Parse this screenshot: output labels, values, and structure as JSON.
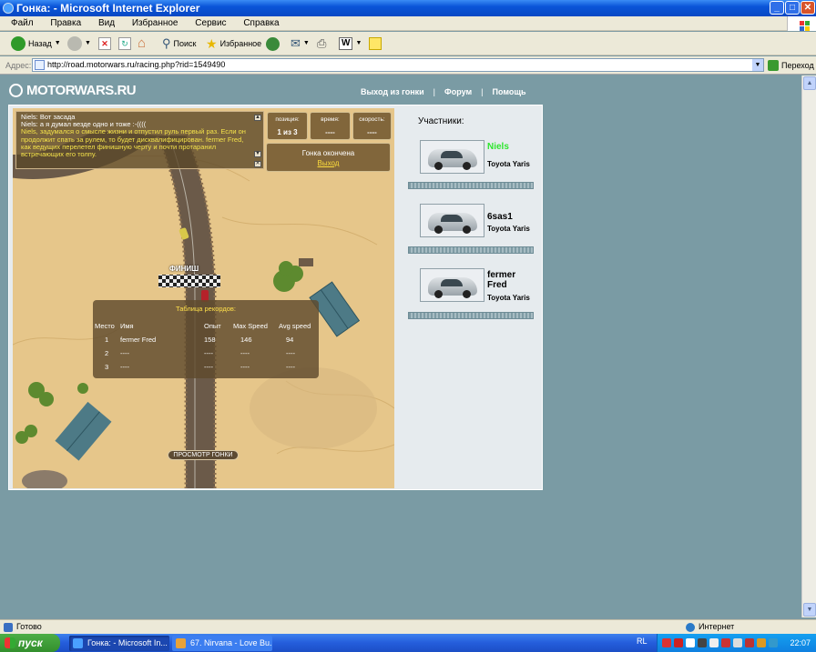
{
  "window": {
    "title": "Гонка: - Microsoft Internet Explorer"
  },
  "menu": [
    "Файл",
    "Правка",
    "Вид",
    "Избранное",
    "Сервис",
    "Справка"
  ],
  "toolbar": {
    "back": "Назад",
    "search": "Поиск",
    "favorites": "Избранное"
  },
  "address": {
    "label": "Адрес:",
    "url": "http://road.motorwars.ru/racing.php?rid=1549490",
    "go": "Переход"
  },
  "site": {
    "logo": "MOTORWARS.RU",
    "nav": [
      "Выход из гонки",
      "Форум",
      "Помощь"
    ]
  },
  "chat": [
    {
      "name": "Niels:",
      "text": "Вот засада"
    },
    {
      "name": "Niels:",
      "text": "а я думал везде одно и тоже :-(((("
    }
  ],
  "chat_system": "Niels, задумался о смысле жизни и отпустил руль первый раз. Если он продолжит спать за рулем, то будет дисквалифицирован. fermer Fred, как ведущих перелетел финишную черту и почти протаранил встречающих его толпу.",
  "stats": {
    "position_label": "позиция:",
    "position": "1 из 3",
    "time_label": "время:",
    "time": "----",
    "speed_label": "скорость:",
    "speed": "----"
  },
  "status": {
    "text": "Гонка окончена",
    "link": "Выход"
  },
  "finish_label": "ФИНИШ",
  "records": {
    "title": "Таблица рекордов:",
    "headers": [
      "Место",
      "Имя",
      "Опыт",
      "Max Speed",
      "Avg speed"
    ],
    "rows": [
      [
        "1",
        "fermer Fred",
        "158",
        "146",
        "94"
      ],
      [
        "2",
        "----",
        "----",
        "----",
        "----"
      ],
      [
        "3",
        "----",
        "----",
        "----",
        "----"
      ]
    ]
  },
  "replay": "ПРОСМОТР ГОНКИ",
  "participants": {
    "label": "Участники:",
    "items": [
      {
        "name": "Niels",
        "model": "Toyota Yaris",
        "name_color": "#2ee62e"
      },
      {
        "name": "6sas1",
        "model": "Toyota Yaris",
        "name_color": "#000000"
      },
      {
        "name": "fermer Fred",
        "model": "Toyota Yaris",
        "name_color": "#000000"
      }
    ]
  },
  "statusbar": {
    "left": "Готово",
    "zone": "Интернет"
  },
  "taskbar": {
    "start": "пуск",
    "tasks": [
      "Гонка: - Microsoft In...",
      "67. Nirvana - Love Bu..."
    ],
    "lang": "RL",
    "clock": "22:07"
  }
}
